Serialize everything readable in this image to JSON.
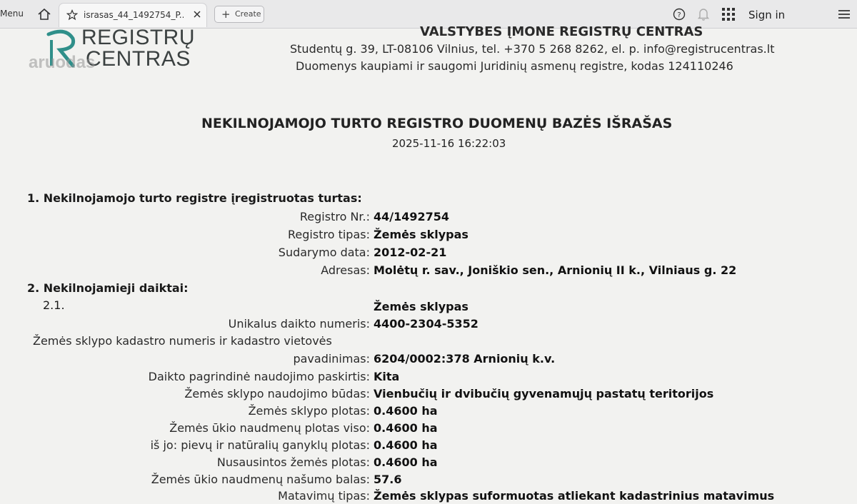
{
  "browser": {
    "menu_label": "Menu",
    "tab_title": "israsas_44_1492754_P...",
    "create_label": "Create",
    "sign_in_label": "Sign in",
    "icons": [
      "home-icon",
      "star-icon",
      "close-icon",
      "plus-icon",
      "help-icon",
      "bell-icon",
      "apps-icon",
      "more-icon"
    ]
  },
  "header": {
    "logo_line1": "REGISTRŲ",
    "logo_line2": "CENTRAS",
    "watermark": "aruodas",
    "org_name": "VALSTYBES ĮMONE REGISTRŲ CENTRAS",
    "org_address": "Studentų g. 39, LT-08106 Vilnius, tel. +370 5 268 8262, el. p. info@registrucentras.lt",
    "org_registry": "Duomenys kaupiami ir saugomi Juridinių asmenų registre, kodas 124110246",
    "brand_color": "#2f8f8a"
  },
  "document": {
    "title": "NEKILNOJAMOJO TURTO REGISTRO DUOMENŲ BAZĖS IŠRAŠAS",
    "datetime": "2025-11-16 16:22:03",
    "section1": {
      "heading": "1. Nekilnojamojo turto registre įregistruotas turtas:",
      "rows": [
        {
          "label": "Registro Nr.:",
          "value": "44/1492754"
        },
        {
          "label": "Registro tipas:",
          "value": "Žemės sklypas"
        },
        {
          "label": "Sudarymo data:",
          "value": "2012-02-21"
        },
        {
          "label": "Adresas:",
          "value": "Molėtų r. sav., Joniškio sen., Arnionių II k., Vilniaus g. 22"
        }
      ]
    },
    "section2": {
      "heading": "2. Nekilnojamieji daiktai:",
      "item_number": "2.1.",
      "item_title": "Žemės sklypas",
      "rows": [
        {
          "label": "Unikalus daikto numeris:",
          "value": "4400-2304-5352"
        },
        {
          "label": "Žemės sklypo kadastro numeris ir kadastro vietovės",
          "value": ""
        },
        {
          "label": "pavadinimas:",
          "value": "6204/0002:378 Arnionių k.v."
        },
        {
          "label": "Daikto pagrindinė naudojimo paskirtis:",
          "value": "Kita"
        },
        {
          "label": "Žemės sklypo naudojimo būdas:",
          "value": "Vienbučių ir dvibučių gyvenamųjų pastatų teritorijos"
        },
        {
          "label": "Žemės sklypo plotas:",
          "value": "0.4600 ha"
        },
        {
          "label": "Žemės ūkio naudmenų plotas viso:",
          "value": "0.4600 ha"
        },
        {
          "label": "iš jo: pievų ir natūralių ganyklų plotas:",
          "value": "0.4600 ha"
        },
        {
          "label": "Nusausintos žemės plotas:",
          "value": "0.4600 ha"
        },
        {
          "label": "Žemės ūkio naudmenų našumo balas:",
          "value": "57.6"
        },
        {
          "label": "Matavimų tipas:",
          "value": "Žemės sklypas suformuotas atliekant kadastrinius matavimus"
        }
      ]
    }
  }
}
